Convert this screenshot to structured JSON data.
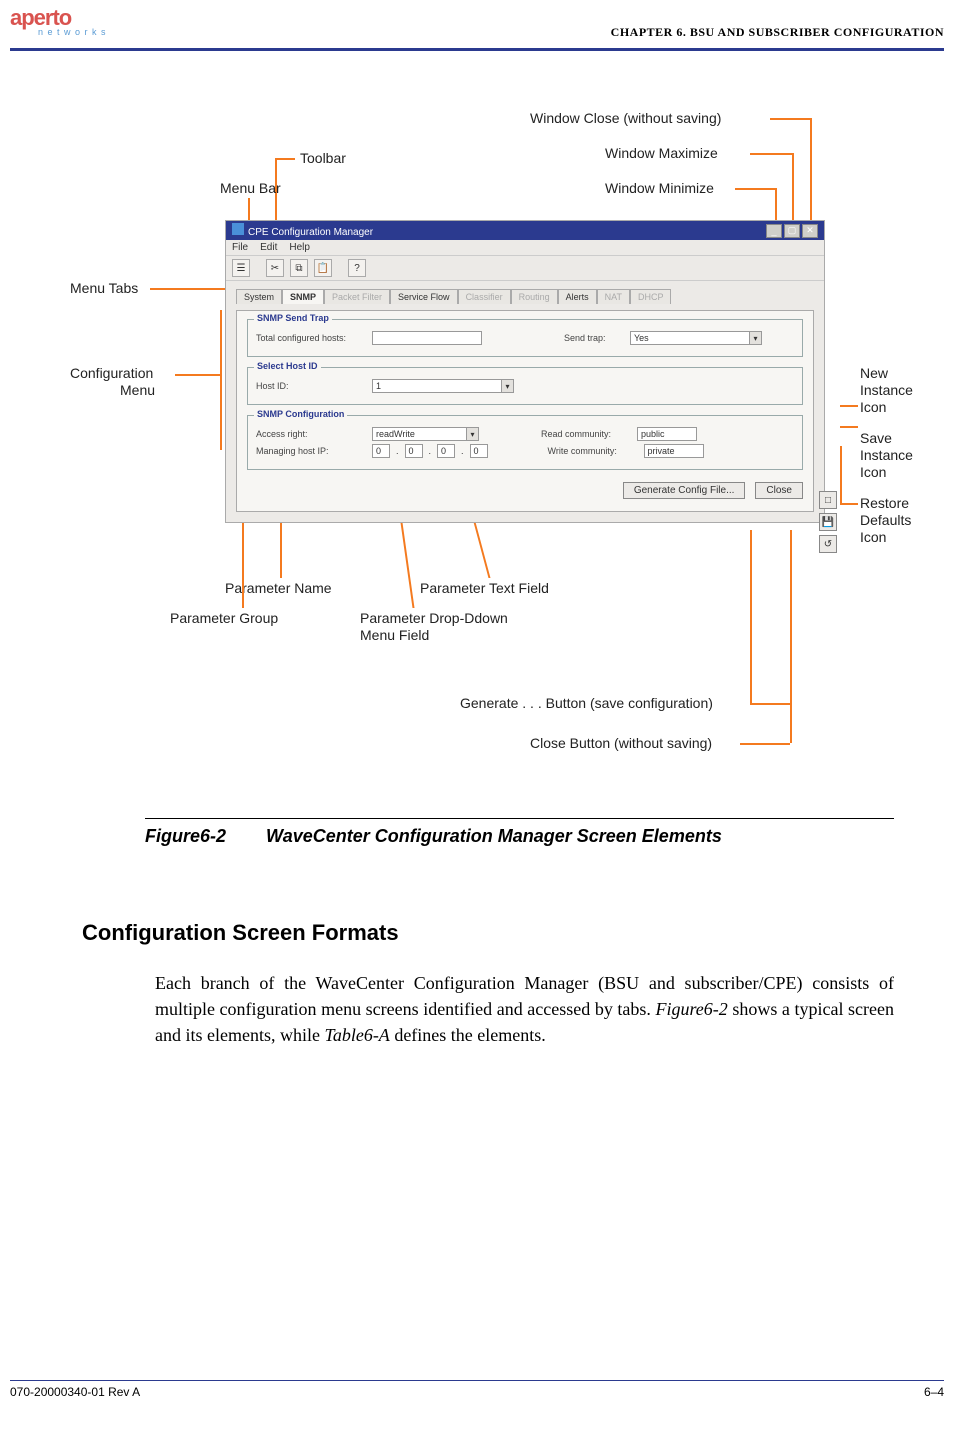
{
  "header": {
    "logo_main": "aperto",
    "logo_sub": "n e t w o r k s",
    "chapter": "CHAPTER 6.   BSU AND SUBSCRIBER CONFIGURATION"
  },
  "callouts": {
    "window_close": "Window Close (without saving)",
    "window_max": "Window Maximize",
    "window_min": "Window Minimize",
    "toolbar": "Toolbar",
    "menu_bar": "Menu Bar",
    "menu_tabs": "Menu Tabs",
    "config_menu_1": "Configuration",
    "config_menu_2": "Menu",
    "new_instance_1": "New",
    "new_instance_2": "Instance",
    "new_instance_3": "Icon",
    "save_instance_1": "Save",
    "save_instance_2": "Instance",
    "save_instance_3": "Icon",
    "restore_1": "Restore",
    "restore_2": "Defaults",
    "restore_3": "Icon",
    "param_name": "Parameter Name",
    "param_group": "Parameter Group",
    "param_text": "Parameter Text Field",
    "param_dd_1": "Parameter Drop-Ddown",
    "param_dd_2": "Menu Field",
    "generate_btn": "Generate . . . Button (save configuration)",
    "close_btn": "Close Button (without saving)"
  },
  "app": {
    "title": "CPE Configuration Manager",
    "menu_file": "File",
    "menu_edit": "Edit",
    "menu_help": "Help",
    "tabs": {
      "system": "System",
      "snmp": "SNMP",
      "packet_filter": "Packet Filter",
      "service_flow": "Service Flow",
      "classifier": "Classifier",
      "routing": "Routing",
      "alerts": "Alerts",
      "nat": "NAT",
      "dhcp": "DHCP"
    },
    "group1": {
      "title": "SNMP Send Trap",
      "total_hosts_lbl": "Total configured hosts:",
      "total_hosts_val": "",
      "send_trap_lbl": "Send trap:",
      "send_trap_val": "Yes"
    },
    "group2": {
      "title": "Select Host ID",
      "host_id_lbl": "Host ID:",
      "host_id_val": "1"
    },
    "group3": {
      "title": "SNMP Configuration",
      "access_lbl": "Access right:",
      "access_val": "readWrite",
      "mgmt_ip_lbl": "Managing host IP:",
      "ip_a": "0",
      "ip_b": "0",
      "ip_c": "0",
      "ip_d": "0",
      "read_comm_lbl": "Read community:",
      "read_comm_val": "public",
      "write_comm_lbl": "Write community:",
      "write_comm_val": "private"
    },
    "generate_btn": "Generate Config File...",
    "close_btn": "Close"
  },
  "figure": {
    "number": "Figure6-2",
    "title": "WaveCenter Configuration Manager Screen Elements"
  },
  "section": {
    "heading": "Configuration Screen Formats",
    "p1a": "Each branch of the WaveCenter Configuration Manager (BSU and subscriber/CPE) consists of multiple configuration menu screens identified and accessed by tabs. ",
    "p1b": "Figure6-2",
    "p1c": "  shows a typical screen and its elements, while ",
    "p1d": "Table6-A",
    "p1e": "  defines the elements."
  },
  "footer": {
    "left": "070-20000340-01 Rev A",
    "right": "6–4"
  }
}
